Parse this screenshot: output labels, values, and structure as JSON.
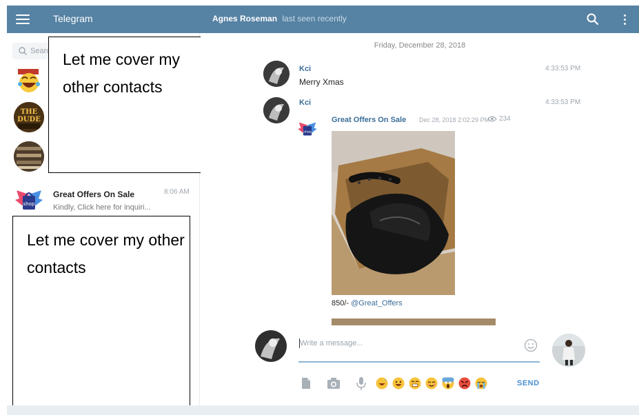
{
  "header": {
    "app_title": "Telegram",
    "peer_name": "Agnes Roseman",
    "peer_status": "last seen recently"
  },
  "sidebar": {
    "search_placeholder": "Search",
    "chats": [
      {
        "name": "Great Offers On Sale",
        "time": "8:06 AM",
        "preview": "Kindly, Click here for inquiri..."
      }
    ],
    "cover_notes": [
      "Let me cover my other contacts",
      "Let me cover my other contacts"
    ]
  },
  "chat": {
    "date_separator": "Friday, December 28, 2018",
    "messages": [
      {
        "author": "Kci",
        "time": "4:33:53 PM",
        "text": "Merry Xmas"
      },
      {
        "author": "Kci",
        "time": "4:33:53 PM"
      }
    ],
    "forwarded": {
      "name": "Great Offers On Sale",
      "date": "Dec 28, 2018 2:02:29 PM",
      "views": "234",
      "price": "850/-",
      "handle": "@Great_Offers",
      "shop_badge": "shop"
    }
  },
  "composer": {
    "placeholder": "Write a message...",
    "send_label": "SEND",
    "emojis": [
      "😅",
      "😃",
      "😁",
      "😊",
      "😱",
      "😡",
      "😭"
    ]
  },
  "colors": {
    "header_bg": "#5682a3",
    "link": "#3a6d99",
    "send": "#4a8fd3"
  }
}
